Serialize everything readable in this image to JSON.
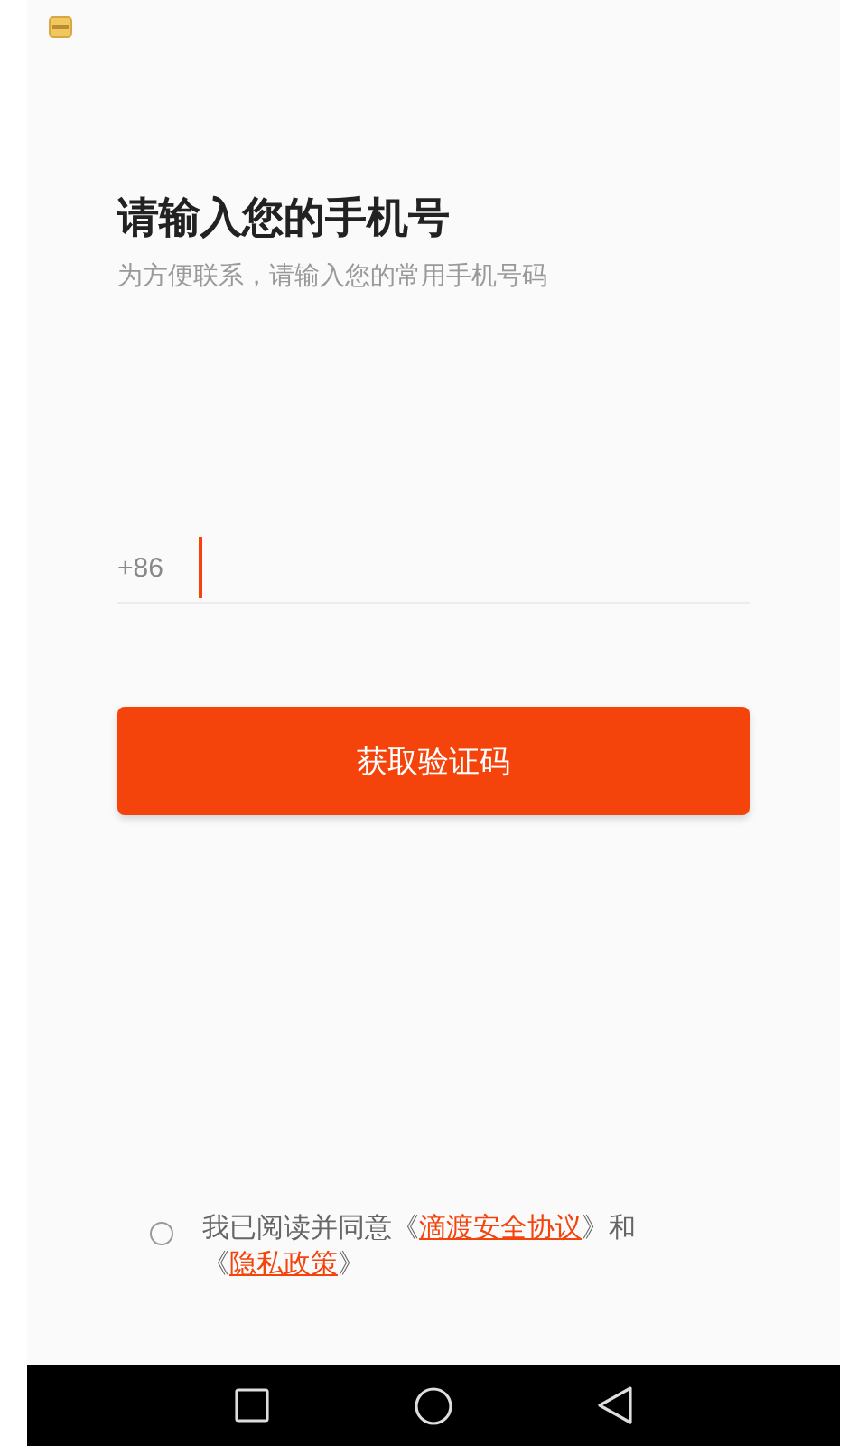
{
  "title": "请输入您的手机号",
  "subtitle": "为方便联系，请输入您的常用手机号码",
  "phone_field": {
    "prefix": "+86",
    "focused": true
  },
  "submit_button": "获取验证码",
  "agreement": {
    "checked": false,
    "parts": [
      {
        "kind": "text",
        "text": "我已阅读并同意《"
      },
      {
        "kind": "link",
        "text": "滴渡安全协议"
      },
      {
        "kind": "text",
        "text": "》和《"
      },
      {
        "kind": "link",
        "text": "隐私政策"
      },
      {
        "kind": "text",
        "text": "》"
      }
    ]
  }
}
